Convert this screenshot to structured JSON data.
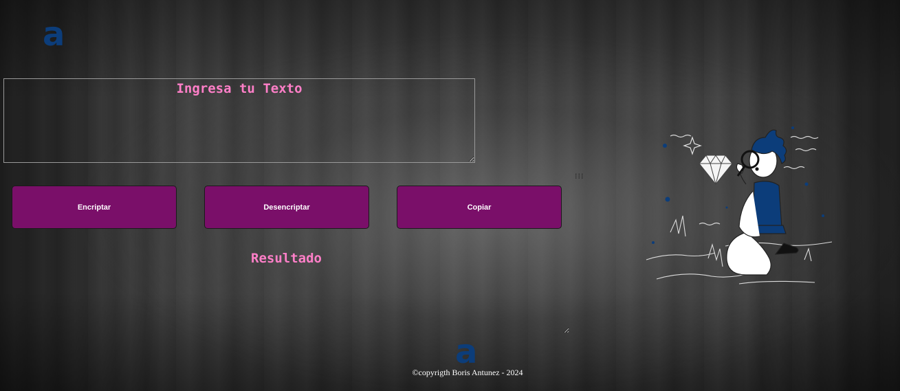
{
  "header": {
    "logo_text": "a",
    "logo_icon": "alura-logo-icon"
  },
  "encoder": {
    "input_placeholder": "Ingresa tu Texto",
    "input_value": "",
    "buttons": {
      "encrypt_label": "Encriptar",
      "decrypt_label": "Desencriptar",
      "copy_label": "Copiar"
    },
    "result_placeholder": "Resultado",
    "result_value": ""
  },
  "illustration": {
    "icon": "person-with-magnifier-and-diamond-illustration"
  },
  "footer": {
    "logo_text": "a",
    "copyright": "©copyrigth Boris Antunez - 2024"
  },
  "colors": {
    "accent_text": "#ff7fc8",
    "button_bg": "#7a0f69",
    "logo": "#0c3d7a"
  }
}
